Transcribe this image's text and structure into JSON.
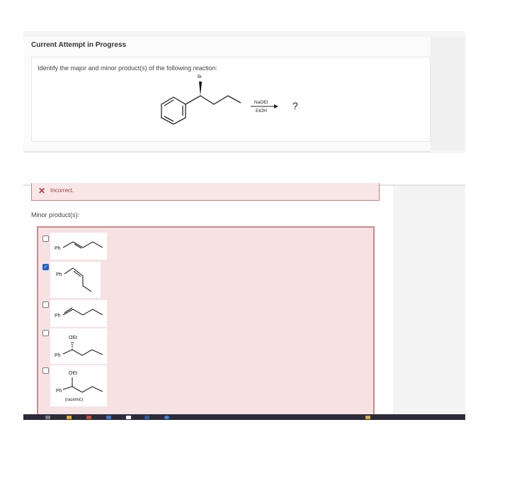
{
  "attempt": {
    "title": "Current Attempt in Progress"
  },
  "question": {
    "text": "Identify the major and minor product(s) of the following reaction:",
    "reactant_substituent": "Br",
    "reagent_top": "NaOEt",
    "reagent_bottom": "EtOH",
    "product_placeholder": "?"
  },
  "feedback": {
    "icon": "x-icon",
    "text": "Incorrect."
  },
  "minor_section": {
    "label": "Minor product(s):",
    "choices": [
      {
        "group": "Ph",
        "checked": false
      },
      {
        "group": "Ph",
        "checked": true
      },
      {
        "group": "Ph",
        "checked": false
      },
      {
        "group": "Ph",
        "substituent": "OEt",
        "checked": false
      },
      {
        "group": "Ph",
        "substituent": "OEt",
        "note": "(racemic)",
        "checked": false
      }
    ]
  },
  "colors": {
    "error_border": "#c98a8a",
    "error_fill": "#f6e1e3",
    "checkbox_checked": "#1f5fc4",
    "taskbar": "#2b2b3a"
  }
}
